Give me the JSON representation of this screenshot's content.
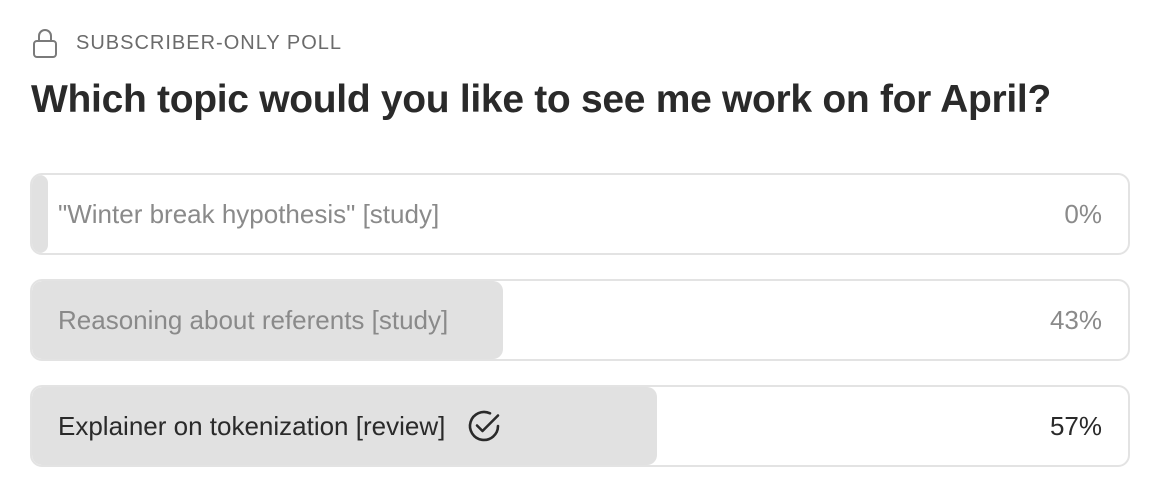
{
  "poll": {
    "tag": "SUBSCRIBER-ONLY POLL",
    "lock_icon": "lock-icon",
    "question": "Which topic would you like to see me work on for April?",
    "options": [
      {
        "label": "\"Winter break hypothesis\" [study]",
        "percent_text": "0%",
        "percent": 0,
        "selected": false
      },
      {
        "label": "Reasoning about referents [study]",
        "percent_text": "43%",
        "percent": 43,
        "selected": false
      },
      {
        "label": "Explainer on tokenization [review]",
        "percent_text": "57%",
        "percent": 57,
        "selected": true,
        "selected_icon": "check-circle-icon"
      }
    ]
  },
  "colors": {
    "fill": "#e1e1e1",
    "border": "#e3e3e3",
    "text_dark": "#2a2a2a",
    "text_muted": "#8a8a8a"
  }
}
